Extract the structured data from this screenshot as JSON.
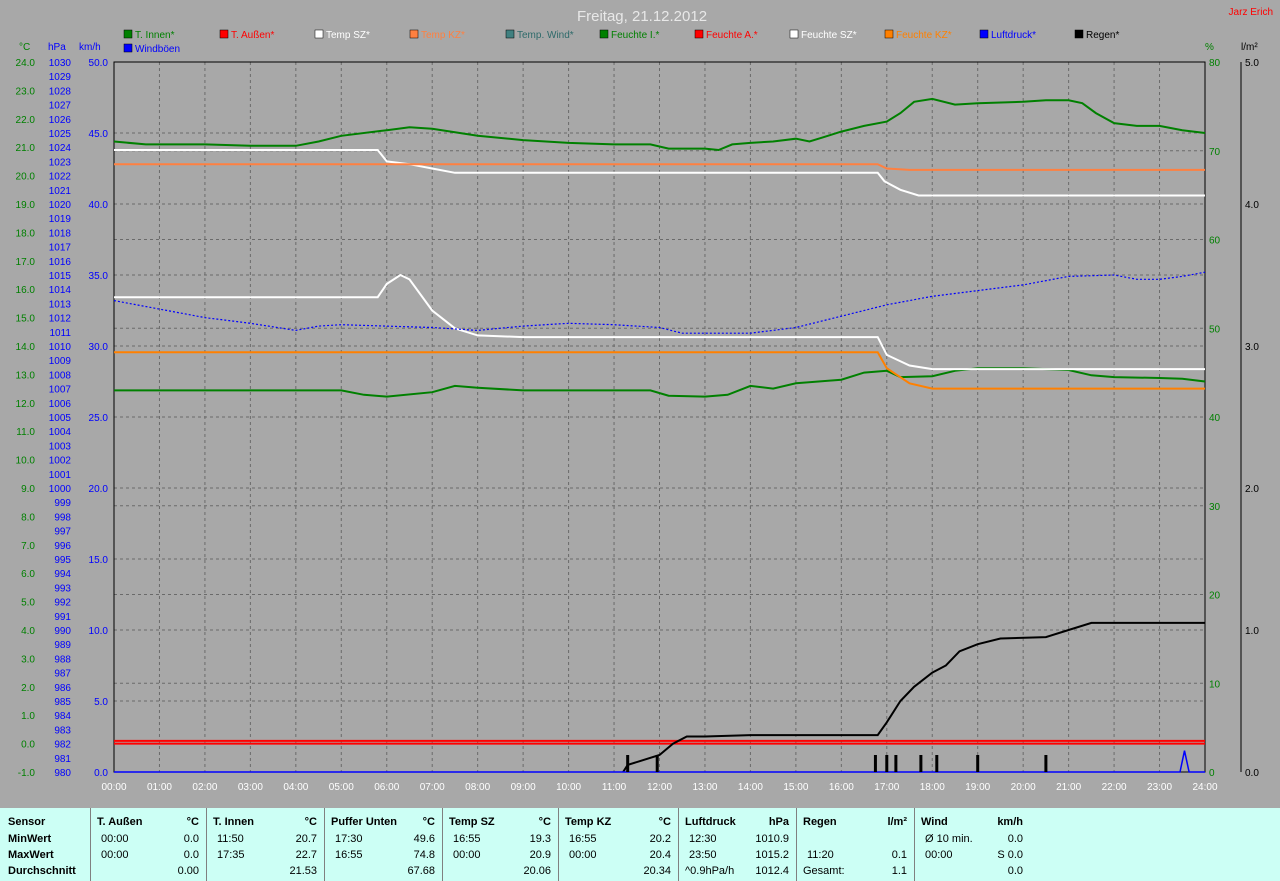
{
  "title": "Freitag, 21.12.2012",
  "author": "Jarz Erich",
  "units": {
    "celsius": "°C",
    "hpa": "hPa",
    "kmh": "km/h",
    "percent": "%",
    "rain": "l/m²"
  },
  "legend": [
    {
      "label": "T. Innen*",
      "color": "#008000"
    },
    {
      "label": "T. Außen*",
      "color": "#ff0000"
    },
    {
      "label": "Temp SZ*",
      "color": "#ffffff"
    },
    {
      "label": "Temp KZ*",
      "color": "#ff8040"
    },
    {
      "label": "Temp. Wind*",
      "color": "#408080"
    },
    {
      "label": "Feuchte I.*",
      "color": "#008000"
    },
    {
      "label": "Feuchte A.*",
      "color": "#ff0000"
    },
    {
      "label": "Feuchte SZ*",
      "color": "#ffffff"
    },
    {
      "label": "Feuchte KZ*",
      "color": "#ff8000"
    },
    {
      "label": "Luftdruck*",
      "color": "#0000ff"
    },
    {
      "label": "Regen*",
      "color": "#000000"
    },
    {
      "label": "Windböen",
      "color": "#0000ff"
    }
  ],
  "chart_data": {
    "type": "line",
    "title": "Freitag, 21.12.2012",
    "x_ticks": [
      "00:00",
      "01:00",
      "02:00",
      "03:00",
      "04:00",
      "05:00",
      "06:00",
      "07:00",
      "08:00",
      "09:00",
      "10:00",
      "11:00",
      "12:00",
      "13:00",
      "14:00",
      "15:00",
      "16:00",
      "17:00",
      "18:00",
      "19:00",
      "20:00",
      "21:00",
      "22:00",
      "23:00",
      "24:00"
    ],
    "axes": {
      "temp_c": {
        "range": [
          -1,
          24
        ],
        "ticks": [
          "24.0",
          "23.0",
          "22.0",
          "21.0",
          "20.0",
          "19.0",
          "18.0",
          "17.0",
          "16.0",
          "15.0",
          "14.0",
          "13.0",
          "12.0",
          "11.0",
          "10.0",
          "9.0",
          "8.0",
          "7.0",
          "6.0",
          "5.0",
          "4.0",
          "3.0",
          "2.0",
          "1.0",
          "0.0",
          "-1.0"
        ]
      },
      "pressure_hpa": {
        "range": [
          980,
          1030
        ],
        "ticks": [
          "1030",
          "1029",
          "1028",
          "1027",
          "1026",
          "1025",
          "1024",
          "1023",
          "1022",
          "1021",
          "1020",
          "1019",
          "1018",
          "1017",
          "1016",
          "1015",
          "1014",
          "1013",
          "1012",
          "1011",
          "1010",
          "1009",
          "1008",
          "1007",
          "1006",
          "1005",
          "1004",
          "1003",
          "1002",
          "1001",
          "1000",
          "999",
          "998",
          "997",
          "996",
          "995",
          "994",
          "993",
          "992",
          "991",
          "990",
          "989",
          "988",
          "987",
          "986",
          "985",
          "984",
          "983",
          "982",
          "981",
          "980"
        ]
      },
      "wind_kmh": {
        "range": [
          0,
          50
        ],
        "ticks": [
          "50.0",
          "45.0",
          "40.0",
          "35.0",
          "30.0",
          "25.0",
          "20.0",
          "15.0",
          "10.0",
          "5.0",
          "0.0"
        ]
      },
      "humidity_pct": {
        "range": [
          0,
          80
        ],
        "ticks": [
          "80",
          "70",
          "60",
          "50",
          "40",
          "30",
          "20",
          "10",
          "0"
        ]
      },
      "rain_lm2": {
        "range": [
          0,
          5
        ],
        "ticks": [
          "5.0",
          "4.0",
          "3.0",
          "2.0",
          "1.0",
          "0.0"
        ]
      }
    },
    "series": [
      {
        "name": "T. Innen*",
        "axis": "temp_c",
        "color": "#008000",
        "points": [
          [
            0,
            21.2
          ],
          [
            0.7,
            21.1
          ],
          [
            2,
            21.1
          ],
          [
            3,
            21.05
          ],
          [
            4,
            21.05
          ],
          [
            4.5,
            21.2
          ],
          [
            5,
            21.4
          ],
          [
            6,
            21.6
          ],
          [
            6.5,
            21.7
          ],
          [
            7,
            21.65
          ],
          [
            8,
            21.4
          ],
          [
            9,
            21.25
          ],
          [
            10,
            21.15
          ],
          [
            11,
            21.1
          ],
          [
            11.8,
            21.1
          ],
          [
            12.2,
            20.95
          ],
          [
            13,
            20.95
          ],
          [
            13.3,
            20.9
          ],
          [
            13.6,
            21.1
          ],
          [
            14,
            21.15
          ],
          [
            14.5,
            21.2
          ],
          [
            15,
            21.3
          ],
          [
            15.3,
            21.2
          ],
          [
            15.6,
            21.35
          ],
          [
            16,
            21.55
          ],
          [
            16.5,
            21.75
          ],
          [
            17,
            21.9
          ],
          [
            17.3,
            22.2
          ],
          [
            17.6,
            22.6
          ],
          [
            18,
            22.7
          ],
          [
            18.5,
            22.5
          ],
          [
            19,
            22.55
          ],
          [
            20,
            22.6
          ],
          [
            20.5,
            22.65
          ],
          [
            21,
            22.65
          ],
          [
            21.3,
            22.55
          ],
          [
            21.6,
            22.2
          ],
          [
            22,
            21.85
          ],
          [
            22.5,
            21.75
          ],
          [
            23,
            21.75
          ],
          [
            23.5,
            21.6
          ],
          [
            24,
            21.5
          ]
        ]
      },
      {
        "name": "T. Außen*",
        "axis": "temp_c",
        "color": "#ff0000",
        "points": [
          [
            0,
            0
          ],
          [
            24,
            0
          ]
        ]
      },
      {
        "name": "Temp SZ*",
        "axis": "temp_c",
        "color": "#ffffff",
        "points": [
          [
            0,
            20.9
          ],
          [
            5.8,
            20.9
          ],
          [
            6,
            20.5
          ],
          [
            6.5,
            20.4
          ],
          [
            7,
            20.25
          ],
          [
            7.5,
            20.1
          ],
          [
            9,
            20.1
          ],
          [
            12,
            20.1
          ],
          [
            16.8,
            20.1
          ],
          [
            16.95,
            19.8
          ],
          [
            17.3,
            19.5
          ],
          [
            17.7,
            19.3
          ],
          [
            24,
            19.3
          ]
        ]
      },
      {
        "name": "Temp KZ*",
        "axis": "temp_c",
        "color": "#ff8040",
        "points": [
          [
            0,
            20.4
          ],
          [
            16.8,
            20.4
          ],
          [
            17,
            20.25
          ],
          [
            17.5,
            20.2
          ],
          [
            24,
            20.2
          ]
        ]
      },
      {
        "name": "Feuchte I.*",
        "axis": "humidity_pct",
        "color": "#008000",
        "points": [
          [
            0,
            43
          ],
          [
            5,
            43
          ],
          [
            5.5,
            42.5
          ],
          [
            6,
            42.3
          ],
          [
            7,
            42.8
          ],
          [
            7.5,
            43.5
          ],
          [
            8,
            43.3
          ],
          [
            9,
            43
          ],
          [
            11.8,
            43
          ],
          [
            12.2,
            42.4
          ],
          [
            13,
            42.3
          ],
          [
            13.5,
            42.5
          ],
          [
            14,
            43.5
          ],
          [
            14.5,
            43.2
          ],
          [
            15,
            43.8
          ],
          [
            15.5,
            44
          ],
          [
            16,
            44.2
          ],
          [
            16.5,
            45
          ],
          [
            17,
            45.2
          ],
          [
            17.3,
            44.5
          ],
          [
            18,
            44.6
          ],
          [
            18.5,
            45.2
          ],
          [
            19,
            45.5
          ],
          [
            20,
            45.5
          ],
          [
            21,
            45.3
          ],
          [
            21.5,
            44.7
          ],
          [
            22,
            44.5
          ],
          [
            23,
            44.4
          ],
          [
            23.5,
            44.3
          ],
          [
            24,
            44
          ]
        ]
      },
      {
        "name": "Feuchte A.*",
        "axis": "humidity_pct",
        "color": "#ff0000",
        "points": [
          [
            0,
            3.5
          ],
          [
            24,
            3.5
          ]
        ]
      },
      {
        "name": "Feuchte SZ*",
        "axis": "humidity_pct",
        "color": "#ffffff",
        "points": [
          [
            0,
            53.5
          ],
          [
            5.8,
            53.5
          ],
          [
            6,
            55
          ],
          [
            6.3,
            56
          ],
          [
            6.5,
            55.5
          ],
          [
            7,
            52
          ],
          [
            7.5,
            50
          ],
          [
            8,
            49.2
          ],
          [
            9,
            49
          ],
          [
            16.8,
            49
          ],
          [
            17,
            47
          ],
          [
            17.5,
            45.8
          ],
          [
            18,
            45.4
          ],
          [
            24,
            45.4
          ]
        ]
      },
      {
        "name": "Feuchte KZ*",
        "axis": "humidity_pct",
        "color": "#ff8000",
        "points": [
          [
            0,
            47.3
          ],
          [
            16.8,
            47.3
          ],
          [
            17,
            45.5
          ],
          [
            17.5,
            43.8
          ],
          [
            18,
            43.2
          ],
          [
            24,
            43.2
          ]
        ]
      },
      {
        "name": "Luftdruck*",
        "axis": "pressure_hpa",
        "color": "#0000ff",
        "points": [
          [
            0,
            1013.2
          ],
          [
            1,
            1012.6
          ],
          [
            2,
            1012.0
          ],
          [
            3,
            1011.6
          ],
          [
            4,
            1011.1
          ],
          [
            4.5,
            1011.4
          ],
          [
            5,
            1011.5
          ],
          [
            6,
            1011.4
          ],
          [
            7,
            1011.3
          ],
          [
            8,
            1011.1
          ],
          [
            9,
            1011.4
          ],
          [
            10,
            1011.6
          ],
          [
            11,
            1011.5
          ],
          [
            12,
            1011.3
          ],
          [
            12.5,
            1010.9
          ],
          [
            13,
            1010.9
          ],
          [
            14,
            1010.9
          ],
          [
            15,
            1011.3
          ],
          [
            16,
            1012.1
          ],
          [
            17,
            1012.9
          ],
          [
            18,
            1013.5
          ],
          [
            19,
            1013.9
          ],
          [
            20,
            1014.3
          ],
          [
            21,
            1014.9
          ],
          [
            22,
            1015.0
          ],
          [
            22.5,
            1014.7
          ],
          [
            23,
            1014.7
          ],
          [
            23.5,
            1014.9
          ],
          [
            24,
            1015.2
          ]
        ]
      },
      {
        "name": "Regen*",
        "axis": "rain_lm2",
        "color": "#000000",
        "points": [
          [
            11.2,
            0
          ],
          [
            11.3,
            0.05
          ],
          [
            12,
            0.12
          ],
          [
            12.3,
            0.2
          ],
          [
            12.6,
            0.25
          ],
          [
            13,
            0.25
          ],
          [
            14,
            0.26
          ],
          [
            16.8,
            0.26
          ],
          [
            17,
            0.35
          ],
          [
            17.3,
            0.5
          ],
          [
            17.6,
            0.6
          ],
          [
            18,
            0.7
          ],
          [
            18.3,
            0.75
          ],
          [
            18.6,
            0.85
          ],
          [
            19,
            0.9
          ],
          [
            19.5,
            0.94
          ],
          [
            20.5,
            0.95
          ],
          [
            21,
            1.0
          ],
          [
            21.5,
            1.05
          ],
          [
            24,
            1.05
          ]
        ]
      },
      {
        "name": "Windböen",
        "axis": "wind_kmh",
        "color": "#0000ff",
        "points": [
          [
            0,
            0
          ],
          [
            23.45,
            0
          ],
          [
            23.55,
            1.5
          ],
          [
            23.65,
            0
          ],
          [
            24,
            0
          ]
        ]
      }
    ],
    "rain_bars": [
      11.3,
      11.95,
      16.75,
      17.0,
      17.2,
      17.75,
      18.1,
      19.0,
      20.5
    ],
    "grid": true
  },
  "stats": {
    "sensor": {
      "header": "Sensor",
      "min": "MinWert",
      "max": "MaxWert",
      "avg": "Durchschnitt"
    },
    "t_aussen": {
      "header": "T. Außen",
      "unit": "°C",
      "min_t": "00:00",
      "min_v": "0.0",
      "max_t": "00:00",
      "max_v": "0.0",
      "avg_v": "0.00"
    },
    "t_innen": {
      "header": "T. Innen",
      "unit": "°C",
      "min_t": "11:50",
      "min_v": "20.7",
      "max_t": "17:35",
      "max_v": "22.7",
      "avg_v": "21.53"
    },
    "puffer": {
      "header": "Puffer Unten",
      "unit": "°C",
      "min_t": "17:30",
      "min_v": "49.6",
      "max_t": "16:55",
      "max_v": "74.8",
      "avg_v": "67.68"
    },
    "temp_sz": {
      "header": "Temp SZ",
      "unit": "°C",
      "min_t": "16:55",
      "min_v": "19.3",
      "max_t": "00:00",
      "max_v": "20.9",
      "avg_v": "20.06"
    },
    "temp_kz": {
      "header": "Temp KZ",
      "unit": "°C",
      "min_t": "16:55",
      "min_v": "20.2",
      "max_t": "00:00",
      "max_v": "20.4",
      "avg_v": "20.34"
    },
    "luftdruck": {
      "header": "Luftdruck",
      "unit": "hPa",
      "min_t": "12:30",
      "min_v": "1010.9",
      "max_t": "23:50",
      "max_v": "1015.2",
      "avg_t": "^0.9hPa/h",
      "avg_v": "1012.4"
    },
    "regen": {
      "header": "Regen",
      "unit": "l/m²",
      "max_t": "11:20",
      "max_v": "0.1",
      "avg_t": "Gesamt:",
      "avg_v": "1.1"
    },
    "wind": {
      "header": "Wind",
      "unit": "km/h",
      "min_t": "Ø 10 min.",
      "min_v": "0.0",
      "max_t": "00:00",
      "max_v": "S 0.0",
      "avg_v": "0.0"
    }
  }
}
